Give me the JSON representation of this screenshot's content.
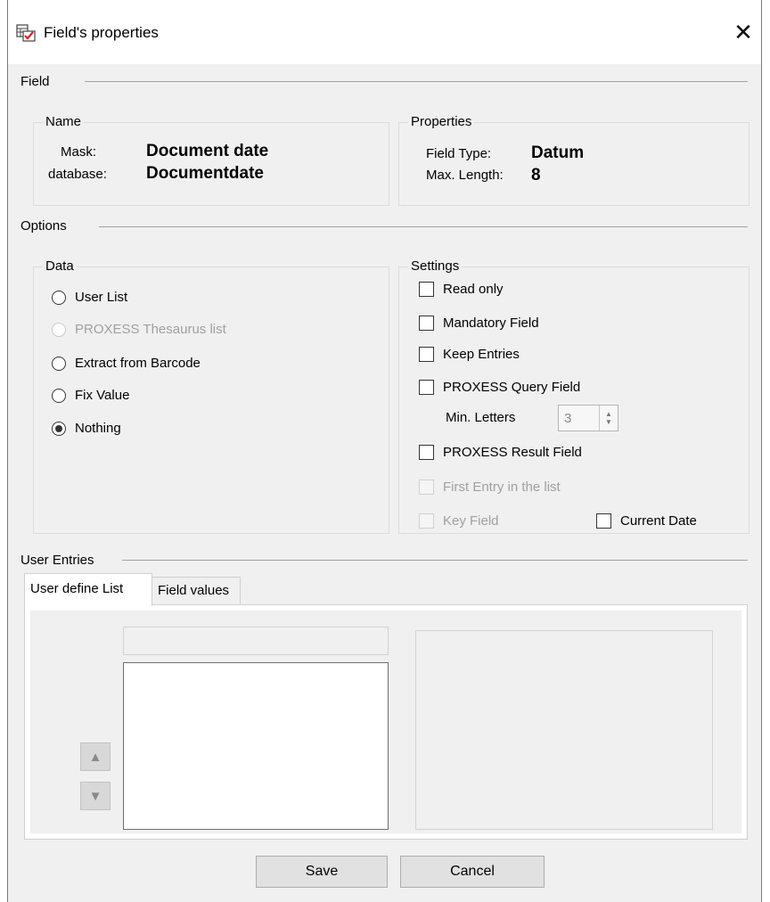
{
  "window": {
    "title": "Field's properties",
    "icon": "table-check-icon",
    "close_glyph": "✕"
  },
  "field_section": {
    "label": "Field",
    "name_group": {
      "title": "Name",
      "mask_label": "Mask:",
      "mask_value": "Document date",
      "database_label": "database:",
      "database_value": "Documentdate"
    },
    "properties_group": {
      "title": "Properties",
      "field_type_label": "Field Type:",
      "field_type_value": "Datum",
      "max_length_label": "Max. Length:",
      "max_length_value": "8"
    }
  },
  "options_section": {
    "label": "Options",
    "data_group": {
      "title": "Data",
      "options": [
        {
          "label": "User List",
          "checked": false,
          "enabled": true
        },
        {
          "label": "PROXESS Thesaurus list",
          "checked": false,
          "enabled": false
        },
        {
          "label": "Extract from Barcode",
          "checked": false,
          "enabled": true
        },
        {
          "label": "Fix Value",
          "checked": false,
          "enabled": true
        },
        {
          "label": "Nothing",
          "checked": true,
          "enabled": true
        }
      ]
    },
    "settings_group": {
      "title": "Settings",
      "read_only": "Read only",
      "mandatory_field": "Mandatory Field",
      "keep_entries": "Keep Entries",
      "proxess_query_field": "PROXESS Query Field",
      "min_letters_label": "Min. Letters",
      "min_letters_value": "3",
      "proxess_result_field": "PROXESS Result Field",
      "first_entry": "First Entry in the list",
      "key_field": "Key Field",
      "current_date": "Current Date"
    }
  },
  "user_entries_section": {
    "label": "User Entries",
    "tabs": [
      {
        "label": "User define List",
        "active": true
      },
      {
        "label": "Field values",
        "active": false
      }
    ]
  },
  "buttons": {
    "save": "Save",
    "cancel": "Cancel"
  }
}
